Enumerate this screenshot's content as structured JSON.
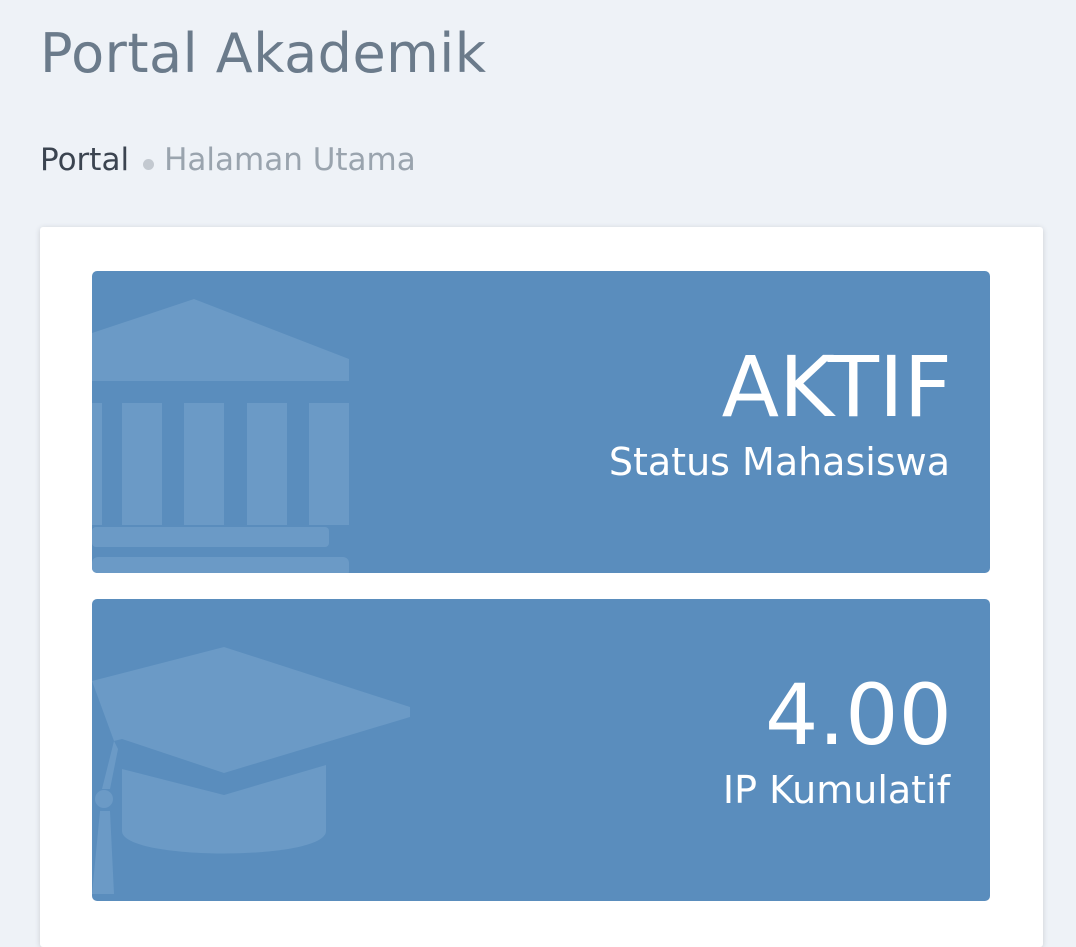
{
  "header": {
    "title": "Portal Akademik"
  },
  "breadcrumb": {
    "root": "Portal",
    "current": "Halaman Utama"
  },
  "stats": [
    {
      "value": "AKTIF",
      "label": "Status Mahasiswa",
      "icon": "university-building-icon",
      "color": "#5a8dbd"
    },
    {
      "value": "4.00",
      "label": "IP Kumulatif",
      "icon": "graduation-cap-icon",
      "color": "#5a8dbd"
    }
  ],
  "colors": {
    "page_background": "#eef2f7",
    "tile_background": "#5a8dbd",
    "tile_icon": "#6b9ac6"
  }
}
